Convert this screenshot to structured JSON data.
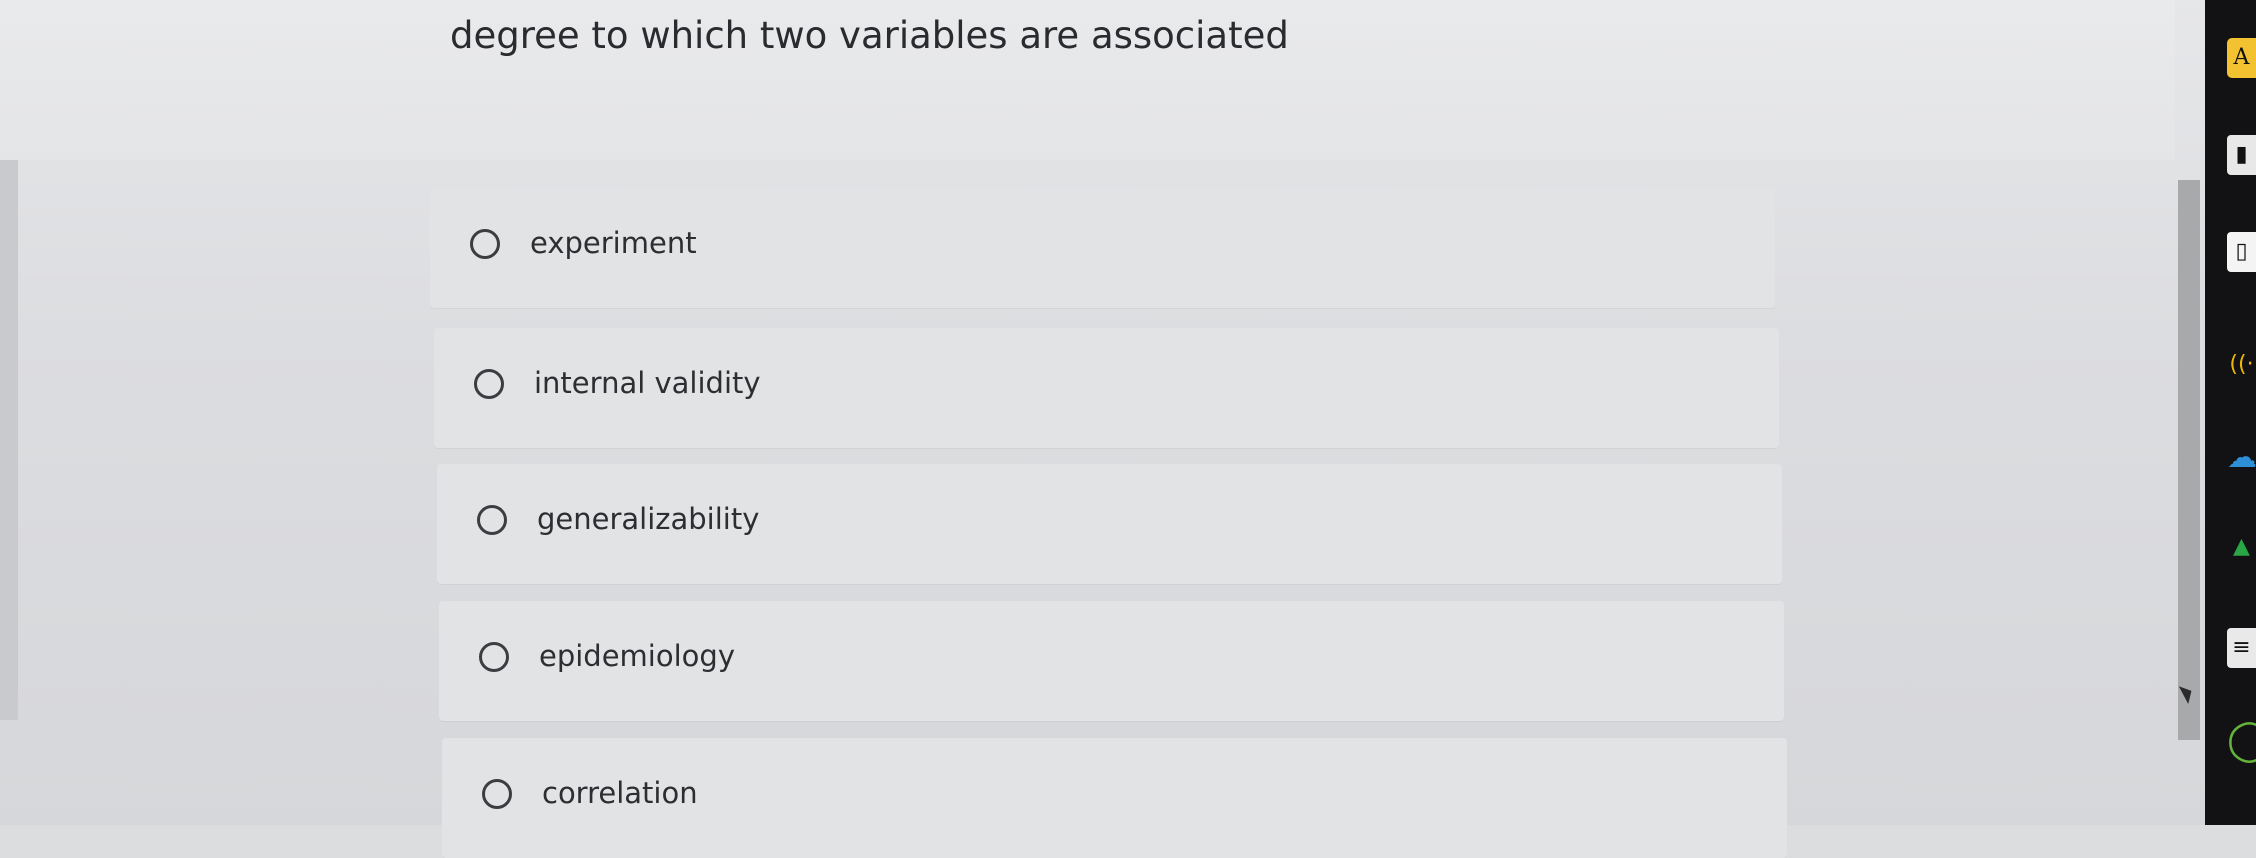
{
  "question": {
    "text": "degree to which two variables are associated"
  },
  "options": [
    {
      "label": "experiment",
      "selected": false
    },
    {
      "label": "internal validity",
      "selected": false
    },
    {
      "label": "generalizability",
      "selected": false
    },
    {
      "label": "epidemiology",
      "selected": false
    },
    {
      "label": "correlation",
      "selected": false
    }
  ],
  "taskbar": {
    "icons": [
      {
        "name": "text-app-icon",
        "glyph": "A"
      },
      {
        "name": "document-icon",
        "glyph": "▮"
      },
      {
        "name": "bookmark-doc-icon",
        "glyph": "▯"
      },
      {
        "name": "audio-waves-icon",
        "glyph": "((·"
      },
      {
        "name": "cloud-icon",
        "glyph": "☁"
      },
      {
        "name": "drive-icon",
        "glyph": "▲"
      },
      {
        "name": "notes-icon",
        "glyph": "≡"
      },
      {
        "name": "ring-app-icon",
        "glyph": "◯"
      }
    ]
  },
  "colors": {
    "background": "#dcdddf",
    "option_background": "#e2e3e5",
    "text": "#2d2e31",
    "taskbar": "#121214"
  }
}
